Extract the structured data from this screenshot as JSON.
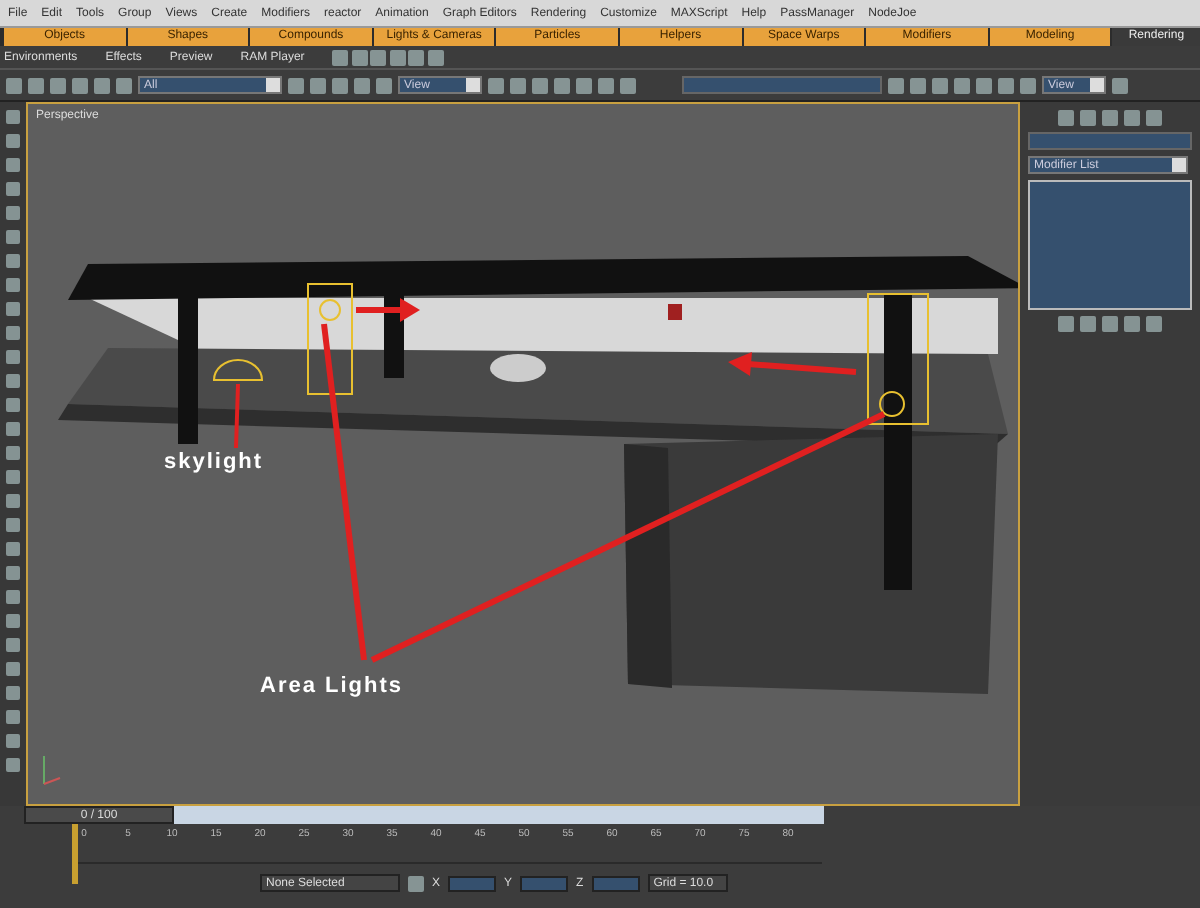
{
  "menu_bar": {
    "items": [
      "File",
      "Edit",
      "Tools",
      "Group",
      "Views",
      "Create",
      "Modifiers",
      "reactor",
      "Animation",
      "Graph Editors",
      "Rendering",
      "Customize",
      "MAXScript",
      "Help",
      "PassManager",
      "NodeJoe"
    ]
  },
  "tab_bar": {
    "tabs": [
      {
        "label": "Objects",
        "selected": false
      },
      {
        "label": "Shapes",
        "selected": false
      },
      {
        "label": "Compounds",
        "selected": false
      },
      {
        "label": "Lights & Cameras",
        "selected": false
      },
      {
        "label": "Particles",
        "selected": false
      },
      {
        "label": "Helpers",
        "selected": false
      },
      {
        "label": "Space Warps",
        "selected": false
      },
      {
        "label": "Modifiers",
        "selected": false
      },
      {
        "label": "Modeling",
        "selected": false
      },
      {
        "label": "Rendering",
        "selected": true
      }
    ]
  },
  "render_toolbar": {
    "items": [
      "Environments",
      "Effects",
      "Preview",
      "RAM Player"
    ]
  },
  "main_toolbar": {
    "dropdowns": [
      "All",
      "View",
      "View"
    ]
  },
  "viewport": {
    "label": "Perspective",
    "annotations": [
      {
        "text": "skylight"
      },
      {
        "text": "Area Lights"
      }
    ]
  },
  "command_panel": {
    "modifier_list": "Modifier List"
  },
  "time_slider": {
    "reading": "0 / 100",
    "level": 0
  },
  "track_bar": {
    "ticks": [
      "0",
      "5",
      "10",
      "15",
      "20",
      "25",
      "30",
      "35",
      "40",
      "45",
      "50",
      "55",
      "60",
      "65",
      "70",
      "75",
      "80"
    ]
  },
  "status_bar": {
    "selection": "None Selected",
    "x_label": "X",
    "y_label": "Y",
    "z_label": "Z",
    "grid": "Grid = 10.0"
  }
}
